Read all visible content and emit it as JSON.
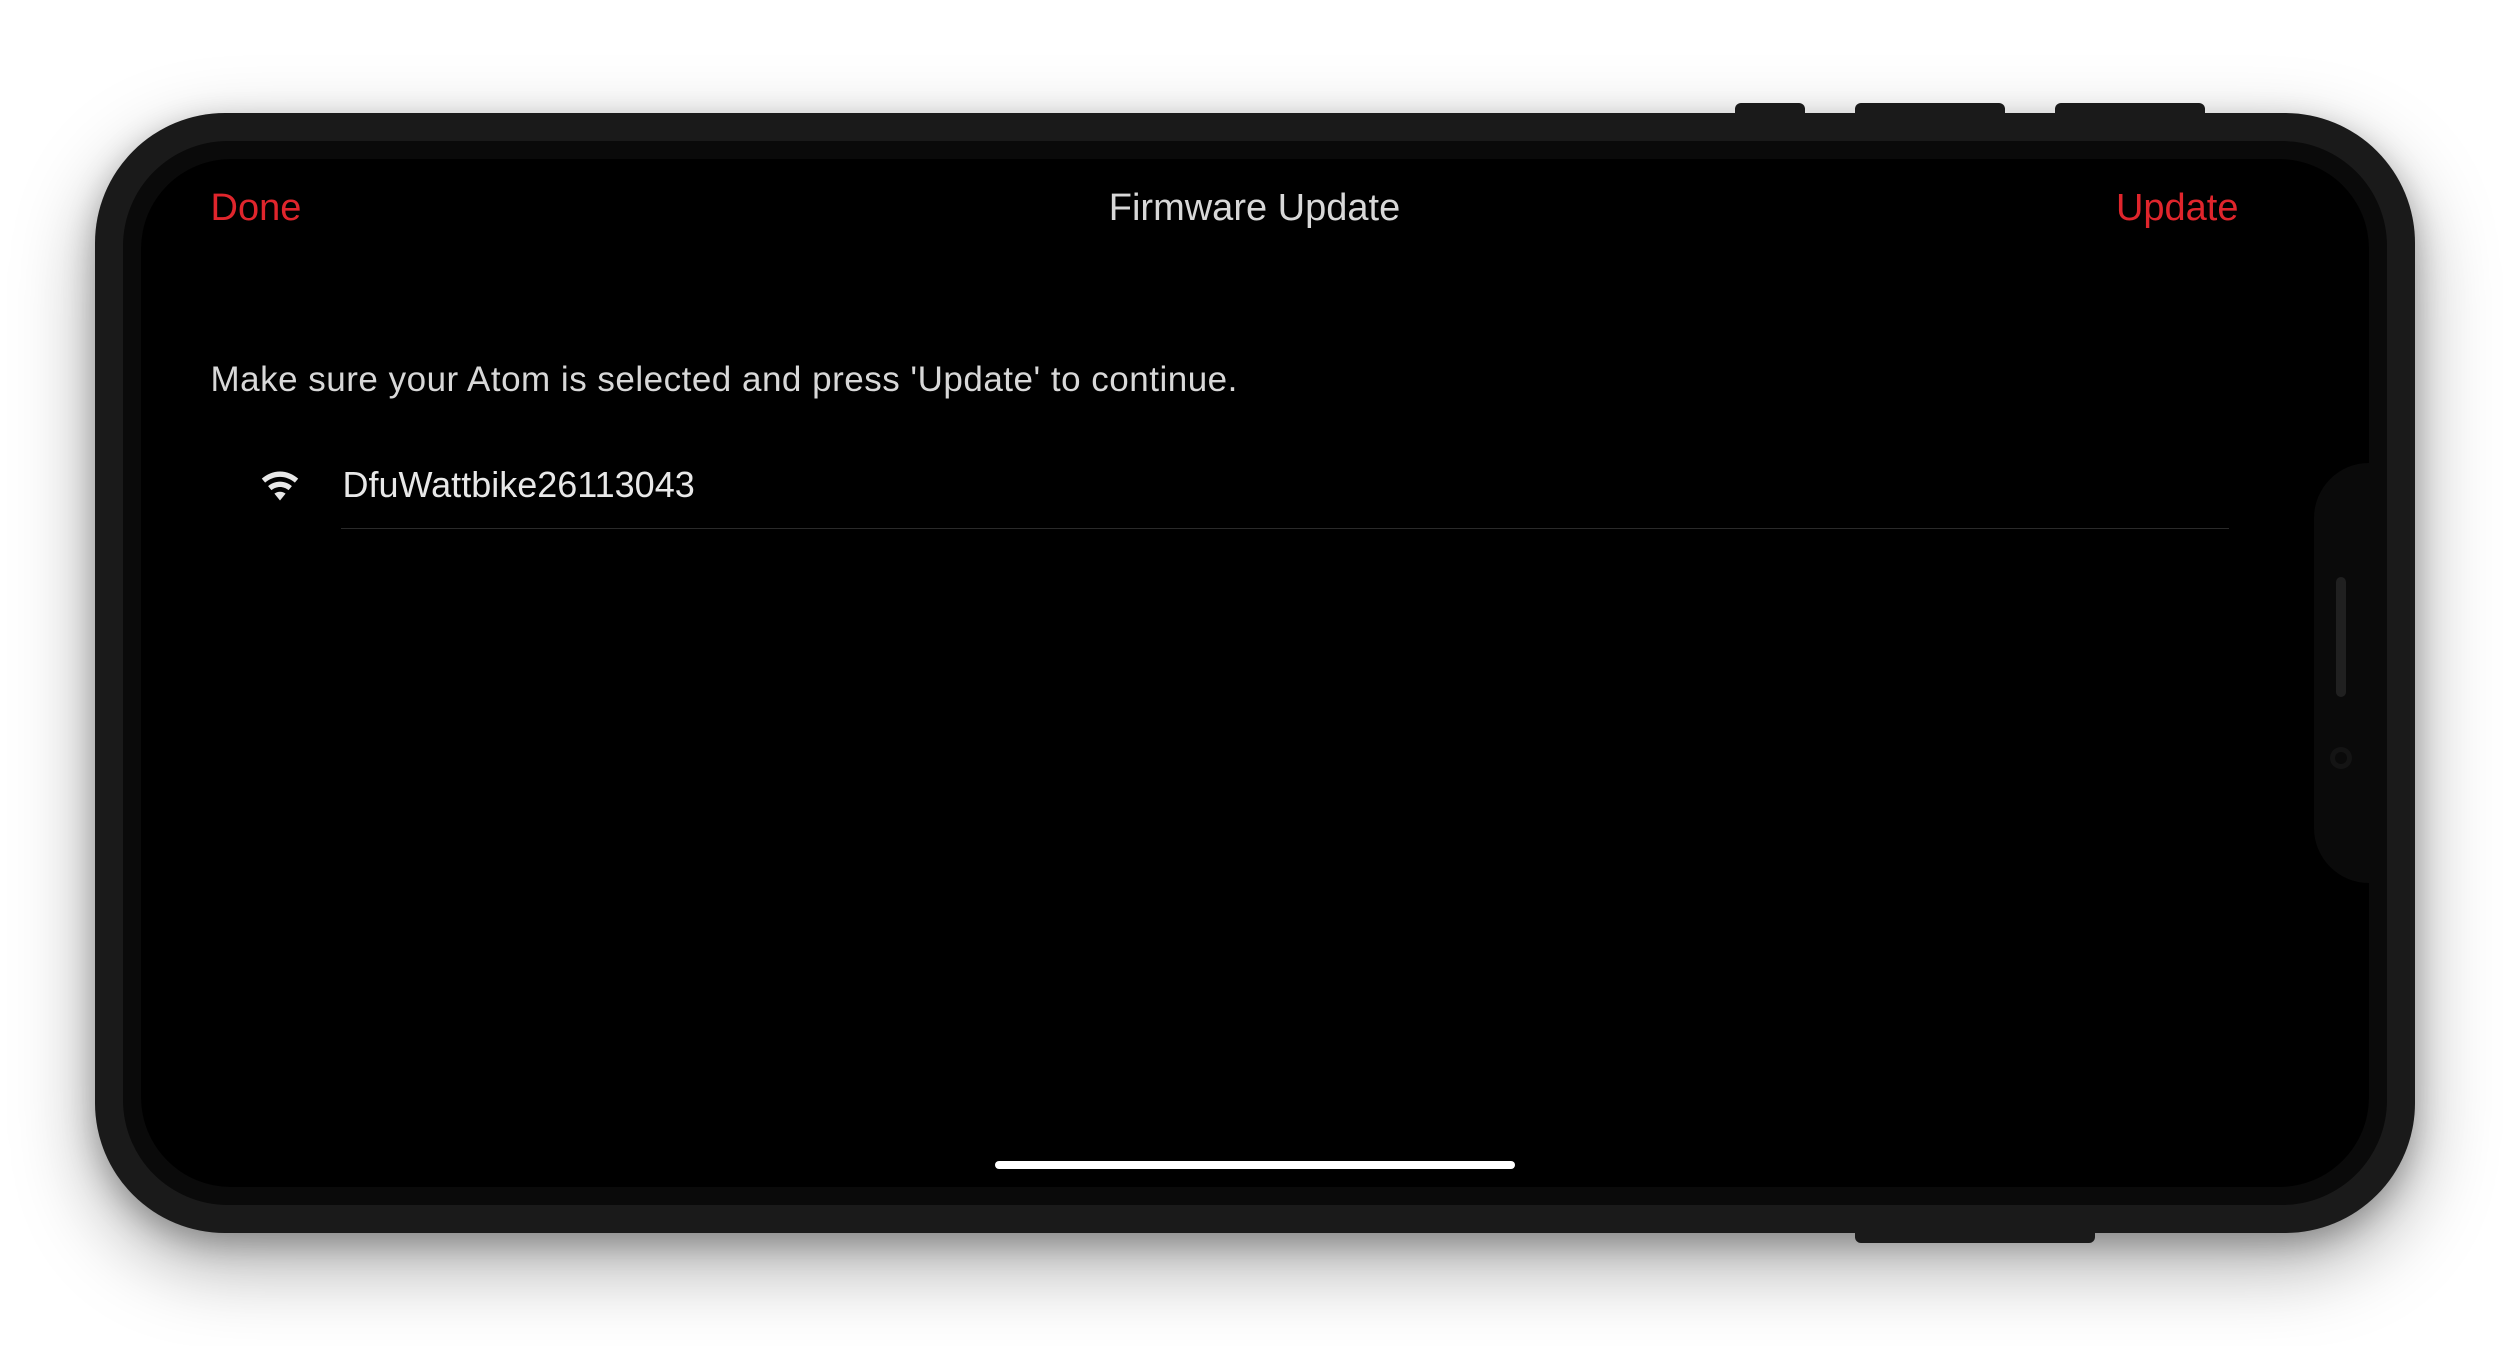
{
  "nav": {
    "done_label": "Done",
    "title": "Firmware Update",
    "update_label": "Update"
  },
  "instruction_text": "Make sure your Atom is selected and press 'Update' to continue.",
  "devices": [
    {
      "name": "DfuWattbike26113043"
    }
  ],
  "colors": {
    "accent": "#e0252c",
    "bg": "#000000",
    "text": "#d8d8d8"
  }
}
